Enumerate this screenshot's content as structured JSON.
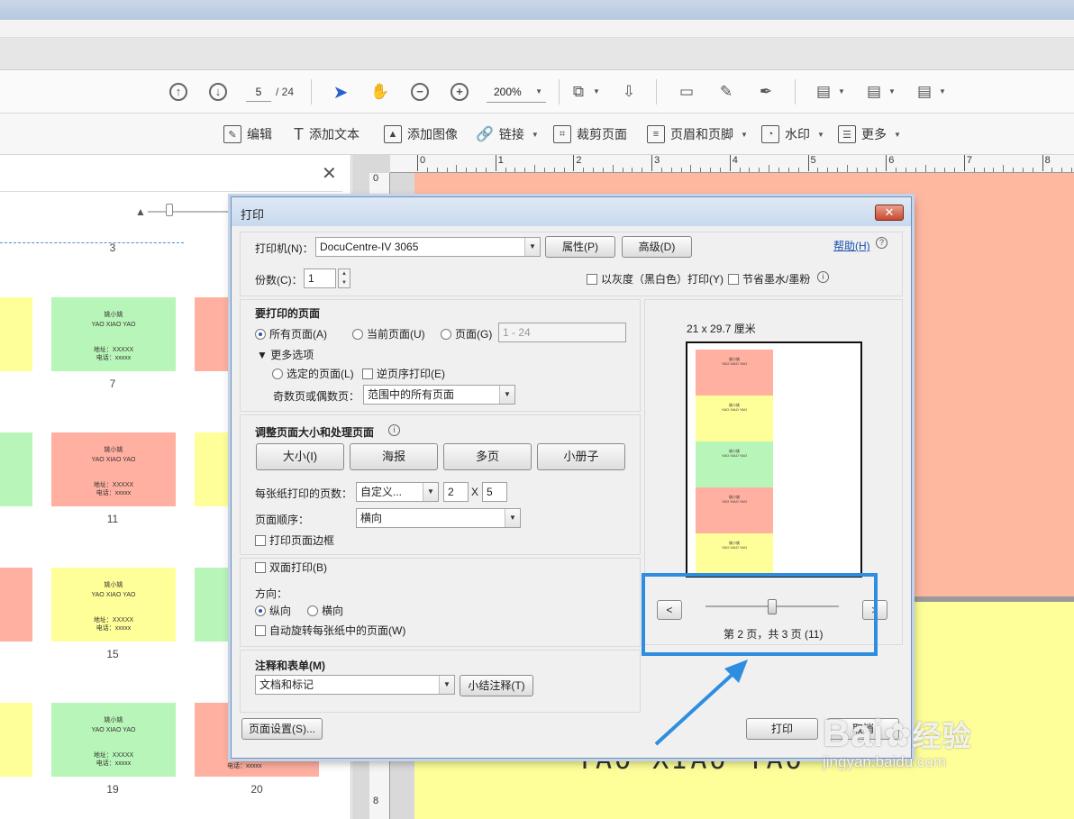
{
  "toolbar": {
    "page_current": "5",
    "page_total": "/ 24",
    "zoom": "200%",
    "edit_items": [
      {
        "label": "编辑",
        "icon": "edit-icon"
      },
      {
        "label": "添加文本",
        "icon": "text-icon"
      },
      {
        "label": "添加图像",
        "icon": "image-icon"
      },
      {
        "label": "链接",
        "icon": "link-icon"
      },
      {
        "label": "裁剪页面",
        "icon": "crop-icon"
      },
      {
        "label": "页眉和页脚",
        "icon": "header-footer-icon"
      },
      {
        "label": "水印",
        "icon": "watermark-icon"
      },
      {
        "label": "更多",
        "icon": "more-icon"
      }
    ]
  },
  "thumbnails": {
    "top_number": "3",
    "card_title": "姚小姚",
    "card_sub": "YAO XIAO YAO",
    "card_addr": "地址：XXXXX",
    "card_phone": "电话：xxxxx",
    "numbers": [
      "7",
      "11",
      "15",
      "19",
      "20"
    ]
  },
  "ruler": {
    "top": [
      "0",
      "1",
      "2",
      "3",
      "4",
      "5",
      "6",
      "7",
      "8"
    ],
    "left": [
      "0",
      "8"
    ]
  },
  "document": {
    "big_text": "YAO XIAO YAO"
  },
  "dialog": {
    "title": "打印",
    "close": "✕",
    "printer_label": "打印机(N)：",
    "printer_value": "DocuCentre-IV 3065",
    "properties_btn": "属性(P)",
    "advanced_btn": "高级(D)",
    "help_link": "帮助(H)",
    "copies_label": "份数(C)：",
    "copies_value": "1",
    "grayscale_label": "以灰度（黑白色）打印(Y)",
    "save_ink_label": "节省墨水/墨粉",
    "pages_section": "要打印的页面",
    "all_pages": "所有页面(A)",
    "current_page": "当前页面(U)",
    "pages_range": "页面(G)",
    "pages_range_placeholder": "1 - 24",
    "more_options": "▼ 更多选项",
    "selected_pages": "选定的页面(L)",
    "reverse_pages": "逆页序打印(E)",
    "odd_even_label": "奇数页或偶数页：",
    "odd_even_value": "范围中的所有页面",
    "resize_section": "调整页面大小和处理页面",
    "size_btn": "大小(I)",
    "poster_btn": "海报",
    "multiple_btn": "多页",
    "booklet_btn": "小册子",
    "pages_per_sheet_label": "每张纸打印的页数：",
    "pages_per_sheet_value": "自定义...",
    "cols_value": "2",
    "x_label": "X",
    "rows_value": "5",
    "page_order_label": "页面顺序：",
    "page_order_value": "横向",
    "print_border": "打印页面边框",
    "duplex": "双面打印(B)",
    "orientation_label": "方向：",
    "portrait": "纵向",
    "landscape": "横向",
    "auto_rotate": "自动旋转每张纸中的页面(W)",
    "comments_section": "注释和表单(M)",
    "comments_value": "文档和标记",
    "summarize_btn": "小结注释(T)",
    "page_setup_btn": "页面设置(S)...",
    "print_btn": "打印",
    "cancel_btn": "取消",
    "paper_size": "21 x 29.7 厘米",
    "prev_btn": "<",
    "next_btn": ">",
    "page_status": "第 2 页，共 3 页 (11)"
  },
  "watermark": {
    "brand": "Bai",
    "brand_cn": "经验",
    "url": "jingyan.baidu.com"
  }
}
